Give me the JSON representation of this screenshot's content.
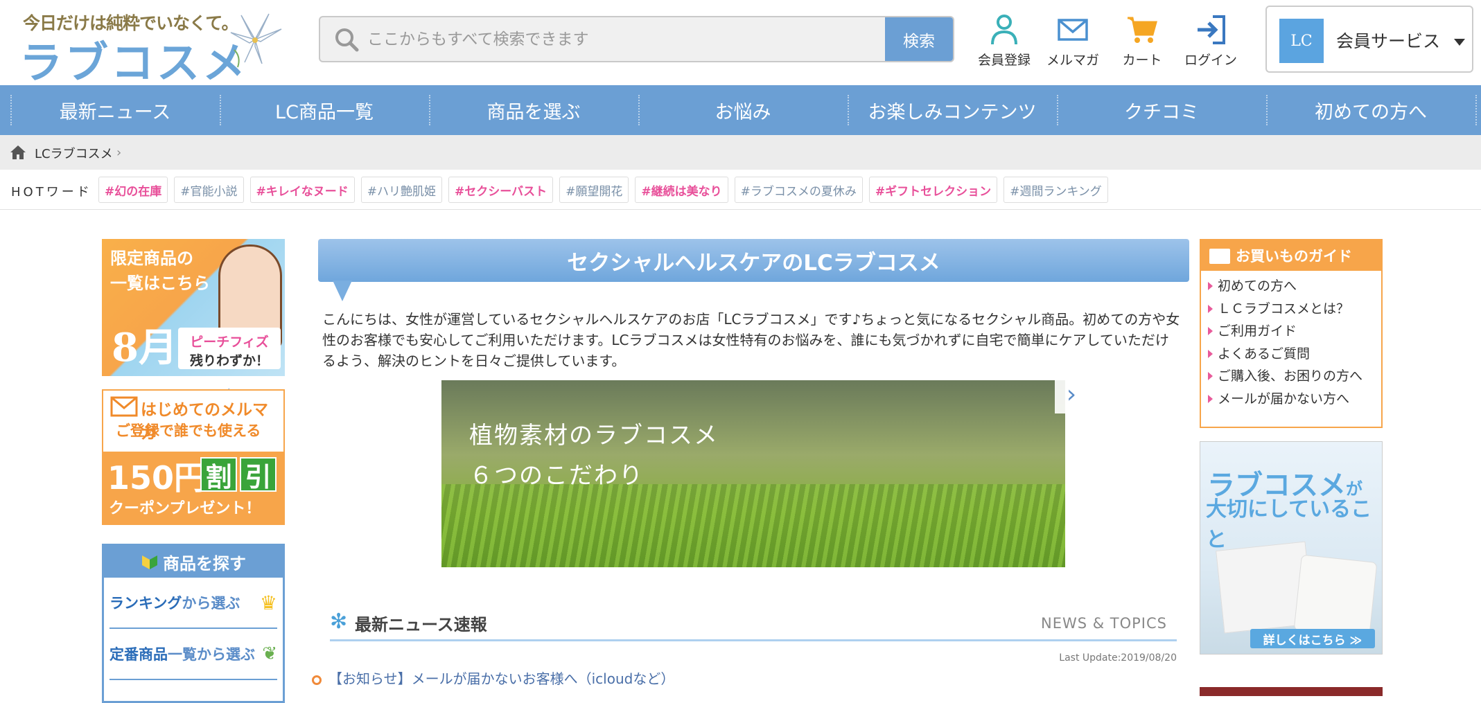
{
  "header": {
    "logo_tagline": "今日だけは純粋でいなくて。",
    "logo_text": "ラブコスメ",
    "search_placeholder": "ここからもすべて検索できます",
    "search_button": "検索",
    "icons": [
      {
        "label": "会員登録",
        "icon": "user-icon"
      },
      {
        "label": "メルマガ",
        "icon": "mail-icon"
      },
      {
        "label": "カート",
        "icon": "cart-icon"
      },
      {
        "label": "ログイン",
        "icon": "login-icon"
      }
    ],
    "member_logo": "LC",
    "member_service": "会員サービス"
  },
  "nav": [
    "最新ニュース",
    "LC商品一覧",
    "商品を選ぶ",
    "お悩み",
    "お楽しみコンテンツ",
    "クチコミ",
    "初めての方へ"
  ],
  "breadcrumb": {
    "label": "LCラブコスメ"
  },
  "hotword": {
    "label": "HOTワード",
    "tags": [
      {
        "text": "#幻の在庫",
        "style": "pink"
      },
      {
        "text": "#官能小説",
        "style": "blue"
      },
      {
        "text": "#キレイなヌード",
        "style": "pink"
      },
      {
        "text": "#ハリ艶肌姫",
        "style": "blue"
      },
      {
        "text": "#セクシーバスト",
        "style": "pink"
      },
      {
        "text": "#願望開花",
        "style": "blue"
      },
      {
        "text": "#継続は美なり",
        "style": "pink"
      },
      {
        "text": "#ラブコスメの夏休み",
        "style": "blue"
      },
      {
        "text": "#ギフトセレクション",
        "style": "pink"
      },
      {
        "text": "#週間ランキング",
        "style": "blue"
      }
    ]
  },
  "left": {
    "banner1": {
      "line1": "限定商品の",
      "line2": "一覧はこちら",
      "month": "8月",
      "badge1": "ピーチフィズ",
      "badge2": "残りわずか！"
    },
    "banner2": {
      "line1": "はじめてのメルマガ",
      "line2": "ご登録で誰でも使える",
      "amount": "150円",
      "w1": "割",
      "w2": "引",
      "coupon": "クーポンプレゼント！"
    },
    "search_box": {
      "title": "商品を探す",
      "rows": [
        {
          "em": "ランキング",
          "rest": "から選ぶ"
        },
        {
          "em": "定番商品",
          "rest": "一覧から選ぶ"
        }
      ]
    }
  },
  "main": {
    "title": "セクシャルヘルスケアのLCラブコスメ",
    "intro": "こんにちは、女性が運営しているセクシャルヘルスケアのお店「LCラブコスメ」です♪ちょっと気になるセクシャル商品。初めての方や女性のお客様でも安心してご利用いただけます。LCラブコスメは女性特有のお悩みを、誰にも気づかれずに自宅で簡単にケアしていただけるよう、解決のヒントを日々ご提供しています。",
    "hero_line1": "植物素材のラブコスメ",
    "hero_line2": "６つのこだわり",
    "news_title": "最新ニュース速報",
    "news_topics": "NEWS & TOPICS",
    "last_update": "Last Update:2019/08/20",
    "news_item1": "【お知らせ】メールが届かないお客様へ（icloudなど）"
  },
  "right": {
    "guide_title": "お買いものガイド",
    "guide_items": [
      "初めての方へ",
      "ＬＣラブコスメとは？",
      "ご利用ガイド",
      "よくあるご質問",
      "ご購入後、お困りの方へ",
      "メールが届かない方へ"
    ],
    "ad_line1": "ラブコスメ",
    "ad_line1_suffix": "が",
    "ad_line2": "大切にしていること",
    "ad_button": "詳しくはこちら ≫"
  },
  "colors": {
    "accent": "#6b9fd4",
    "orange": "#f7a54a",
    "pink": "#e8509a"
  }
}
